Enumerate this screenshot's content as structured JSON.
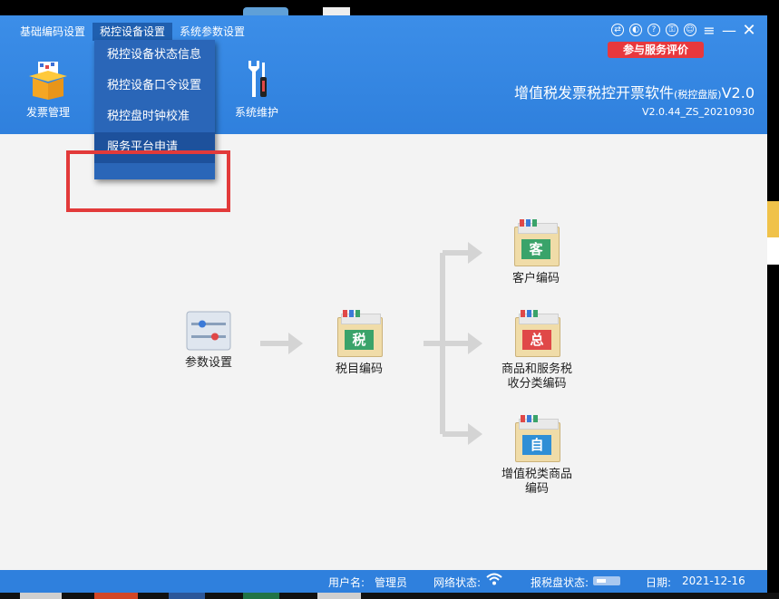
{
  "menubar": {
    "items": [
      "基础编码设置",
      "税控设备设置",
      "系统参数设置"
    ]
  },
  "dropdown": {
    "items": [
      "税控设备状态信息",
      "税控设备口令设置",
      "税控盘时钟校准",
      "服务平台申请"
    ]
  },
  "toolbar": {
    "invoice_label": "发票管理",
    "maintenance_label": "系统维护"
  },
  "header": {
    "app_title": "增值税发票税控开票软件",
    "edition": "(税控盘版)",
    "version_short": "V2.0",
    "version_full": "V2.0.44_ZS_20210930",
    "eval_button": "参与服务评价"
  },
  "workflow": {
    "param": {
      "label": "参数设置"
    },
    "tax": {
      "label": "税目编码",
      "char": "税",
      "color": "#3aa36a"
    },
    "customer": {
      "label": "客户编码",
      "char": "客",
      "color": "#3aa36a"
    },
    "goods": {
      "label": "商品和服务税收分类编码",
      "char": "总",
      "color": "#e04848"
    },
    "vat": {
      "label": "增值税类商品编码",
      "char": "自",
      "color": "#2f8fd6"
    }
  },
  "status": {
    "user_label": "用户名:",
    "user_value": "管理员",
    "network_label": "网络状态:",
    "disk_label": "报税盘状态:",
    "date_label": "日期:",
    "date_value": "2021-12-16"
  },
  "colors": {
    "accent": "#2f80dd",
    "highlight": "#e23a3a",
    "eval": "#e8383d"
  },
  "icons": [
    "theme-icon",
    "skin-icon",
    "help-icon",
    "lock-icon",
    "user-icon",
    "menu-icon",
    "minimize-icon",
    "close-icon",
    "wifi-icon",
    "disk-icon"
  ]
}
